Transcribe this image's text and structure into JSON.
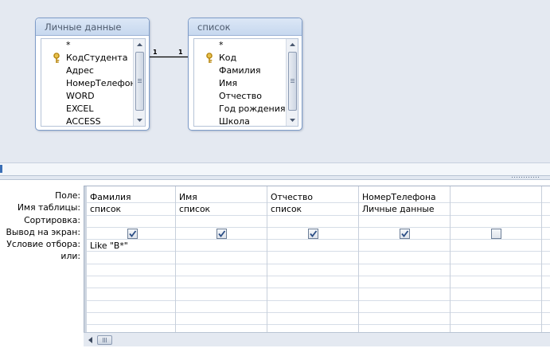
{
  "tables": [
    {
      "title": "Личные данные",
      "fields": [
        {
          "name": "*",
          "key": false
        },
        {
          "name": "КодСтудента",
          "key": true
        },
        {
          "name": "Адрес",
          "key": false
        },
        {
          "name": "НомерТелефона",
          "key": false
        },
        {
          "name": "WORD",
          "key": false
        },
        {
          "name": "EXCEL",
          "key": false
        },
        {
          "name": "ACCESS",
          "key": false
        }
      ]
    },
    {
      "title": "список",
      "fields": [
        {
          "name": "*",
          "key": false
        },
        {
          "name": "Код",
          "key": true
        },
        {
          "name": "Фамилия",
          "key": false
        },
        {
          "name": "Имя",
          "key": false
        },
        {
          "name": "Отчество",
          "key": false
        },
        {
          "name": "Год рождения",
          "key": false
        },
        {
          "name": "Школа",
          "key": false
        }
      ]
    }
  ],
  "relationship": {
    "left_label": "1",
    "right_label": "1"
  },
  "grid": {
    "row_labels": [
      "Поле:",
      "Имя таблицы:",
      "Сортировка:",
      "Вывод на экран:",
      "Условие отбора:",
      "или:"
    ],
    "columns": [
      {
        "field": "Фамилия",
        "table": "список",
        "sort": "",
        "show": true,
        "criteria": "Like \"В*\"",
        "or": ""
      },
      {
        "field": "Имя",
        "table": "список",
        "sort": "",
        "show": true,
        "criteria": "",
        "or": ""
      },
      {
        "field": "Отчество",
        "table": "список",
        "sort": "",
        "show": true,
        "criteria": "",
        "or": ""
      },
      {
        "field": "НомерТелефона",
        "table": "Личные данные",
        "sort": "",
        "show": true,
        "criteria": "",
        "or": ""
      },
      {
        "field": "",
        "table": "",
        "sort": "",
        "show": false,
        "criteria": "",
        "or": ""
      },
      {
        "field": "",
        "table": "",
        "sort": "",
        "show": false,
        "criteria": "",
        "or": ""
      }
    ]
  },
  "colors": {
    "designer_bg": "#e4e9f1",
    "table_border": "#7e9cc8",
    "grid_line": "#d6dde7",
    "checkbox_tick": "#2c4f86",
    "key_icon": "#d4a020"
  }
}
